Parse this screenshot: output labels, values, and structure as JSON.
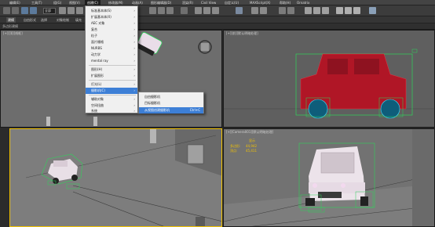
{
  "menubar": {
    "items": [
      "编辑(E)",
      "工具(T)",
      "组(G)",
      "视图(V)",
      "创建(C)",
      "修改器(M)",
      "动画(A)",
      "图形编辑器(D)",
      "渲染(R)",
      "Civil View",
      "自定义(U)",
      "MAXScript(X)",
      "帮助(H)",
      "Ornatrix",
      "Phoenix FD",
      "Tyflow",
      "Rail Clone",
      "Forest Pack"
    ],
    "labels_visible": [
      "编辑(E)",
      "工具(T)",
      "组(G)",
      "视图(V)",
      "创建(C)",
      "修改(M)",
      "动画(A)",
      "图形编辑器(D)",
      "渲染(R)",
      "自定义(U)",
      "MAXScript(X)",
      "帮助(H)",
      "文件(F)",
      "窗口(W)",
      "Arnold",
      "工作区(S)"
    ]
  },
  "topmenu": {
    "m1": "编辑(E)",
    "m2": "工具(T)",
    "m3": "组(G)",
    "m4": "视图(V)",
    "m5": "创建(C)",
    "m6": "修改器(M)",
    "m7": "动画(A)",
    "m8": "图形编辑器(D)",
    "m9": "渲染(R)",
    "m10": "Civil View",
    "m11": "自定义(U)",
    "m12": "MAXScript(X)",
    "m13": "帮助(H)",
    "m14": "Ornatrix"
  },
  "toolbar": {
    "selection_filter": "全部"
  },
  "ribbon": {
    "tab1": "建模",
    "tab2": "自由形式",
    "tab3": "选择",
    "tab4": "对象绘制",
    "tab5": "填充"
  },
  "sublabel": "多边形建模",
  "viewports": {
    "top_left": "[+][顶][线框]",
    "top_right": "[+][前][默认明暗处理]",
    "bottom_left": "[+][透视][默认明暗处理]",
    "bottom_right": "[+][Camera001][默认明暗处理]",
    "camera_info": {
      "title": "显示",
      "line1_label": "多边形:",
      "line1_value": "44,942",
      "line2_label": "顶点:",
      "line2_value": "45,411"
    }
  },
  "create_menu": {
    "items": [
      {
        "label": "标准基本体(S)",
        "submenu": true
      },
      {
        "label": "扩展基本体(X)",
        "submenu": true
      },
      {
        "label": "AEC 对象",
        "submenu": true
      },
      {
        "label": "复合",
        "submenu": true
      },
      {
        "label": "粒子",
        "submenu": true
      },
      {
        "label": "面片栅格",
        "submenu": true
      },
      {
        "label": "NURBS",
        "submenu": true
      },
      {
        "label": "动力学",
        "submenu": true
      },
      {
        "label": "mental ray",
        "submenu": true
      },
      {
        "label": "图形(H)",
        "submenu": true
      },
      {
        "label": "扩展图形",
        "submenu": true
      },
      {
        "label": "灯光(L)",
        "submenu": true
      },
      {
        "label": "摄影机(C)",
        "submenu": true
      },
      {
        "label": "辅助对象",
        "submenu": true
      },
      {
        "label": "空间扭曲",
        "submenu": true
      },
      {
        "label": "系统",
        "submenu": true
      }
    ]
  },
  "camera_submenu": {
    "items": [
      {
        "label": "自由摄影机",
        "shortcut": ""
      },
      {
        "label": "目标摄影机",
        "shortcut": ""
      },
      {
        "label": "从视图创建摄影机",
        "shortcut": "Ctrl+C"
      }
    ]
  },
  "colors": {
    "menu_highlight": "#3d7fd6",
    "active_viewport_border": "#f2c200",
    "car_red": "#c0192a",
    "wire_green": "#2fd35a"
  }
}
